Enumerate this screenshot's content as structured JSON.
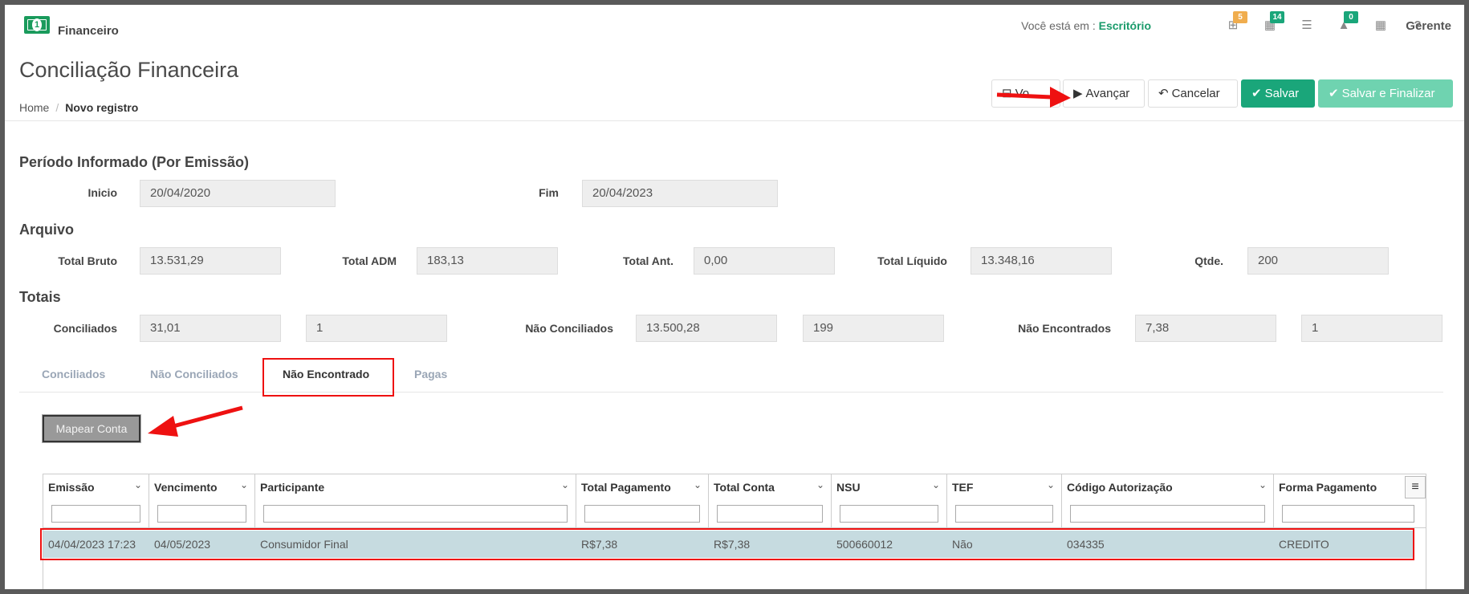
{
  "app": {
    "name": "Financeiro"
  },
  "topbar": {
    "location_label": "Você está em :",
    "location_value": "Escritório",
    "user": "Gerente",
    "icons": [
      {
        "name": "sitemap-icon",
        "glyph": "⊞",
        "badge": "5",
        "badge_color": "#f0ad4e"
      },
      {
        "name": "grid-icon",
        "glyph": "▦",
        "badge": "14",
        "badge_color": "#1aa67a"
      },
      {
        "name": "server-icon",
        "glyph": "☰",
        "badge": "",
        "badge_color": ""
      },
      {
        "name": "bell-icon",
        "glyph": "🔔",
        "badge": "0",
        "badge_color": "#1aa67a"
      },
      {
        "name": "calendar-icon",
        "glyph": "▦",
        "badge": "",
        "badge_color": ""
      },
      {
        "name": "help-icon",
        "glyph": "?",
        "badge": "",
        "badge_color": ""
      }
    ]
  },
  "page": {
    "title": "Conciliação Financeira",
    "breadcrumb_home": "Home",
    "breadcrumb_sep": "/",
    "breadcrumb_current": "Novo registro"
  },
  "actions": {
    "voltar": "Vo",
    "avancar": "Avançar",
    "cancelar": "Cancelar",
    "salvar": "Salvar",
    "salvar_finalizar": "Salvar e Finalizar"
  },
  "periodo": {
    "heading": "Período Informado (Por Emissão)",
    "inicio_label": "Inicio",
    "inicio_value": "20/04/2020",
    "fim_label": "Fim",
    "fim_value": "20/04/2023"
  },
  "arquivo": {
    "heading": "Arquivo",
    "total_bruto_label": "Total Bruto",
    "total_bruto": "13.531,29",
    "total_adm_label": "Total ADM",
    "total_adm": "183,13",
    "total_ant_label": "Total Ant.",
    "total_ant": "0,00",
    "total_liquido_label": "Total Líquido",
    "total_liquido": "13.348,16",
    "qtde_label": "Qtde.",
    "qtde": "200"
  },
  "totais": {
    "heading": "Totais",
    "conciliados_label": "Conciliados",
    "conciliados_valor": "31,01",
    "conciliados_qtd": "1",
    "nao_conciliados_label": "Não Conciliados",
    "nao_conciliados_valor": "13.500,28",
    "nao_conciliados_qtd": "199",
    "nao_encontrados_label": "Não Encontrados",
    "nao_encontrados_valor": "7,38",
    "nao_encontrados_qtd": "1"
  },
  "tabs": [
    "Conciliados",
    "Não Conciliados",
    "Não Encontrado",
    "Pagas"
  ],
  "mapear_button": "Mapear Conta",
  "grid": {
    "columns": [
      "Emissão",
      "Vencimento",
      "Participante",
      "Total Pagamento",
      "Total Conta",
      "NSU",
      "TEF",
      "Código Autorização",
      "Forma Pagamento"
    ],
    "rows": [
      [
        "04/04/2023 17:23",
        "04/05/2023",
        "Consumidor Final",
        "R$7,38",
        "R$7,38",
        "500660012",
        "Não",
        "034335",
        "CREDITO"
      ]
    ]
  },
  "colors": {
    "accent": "#1aa67a",
    "highlight": "#e11111",
    "row_selected": "#c6dbe0"
  }
}
